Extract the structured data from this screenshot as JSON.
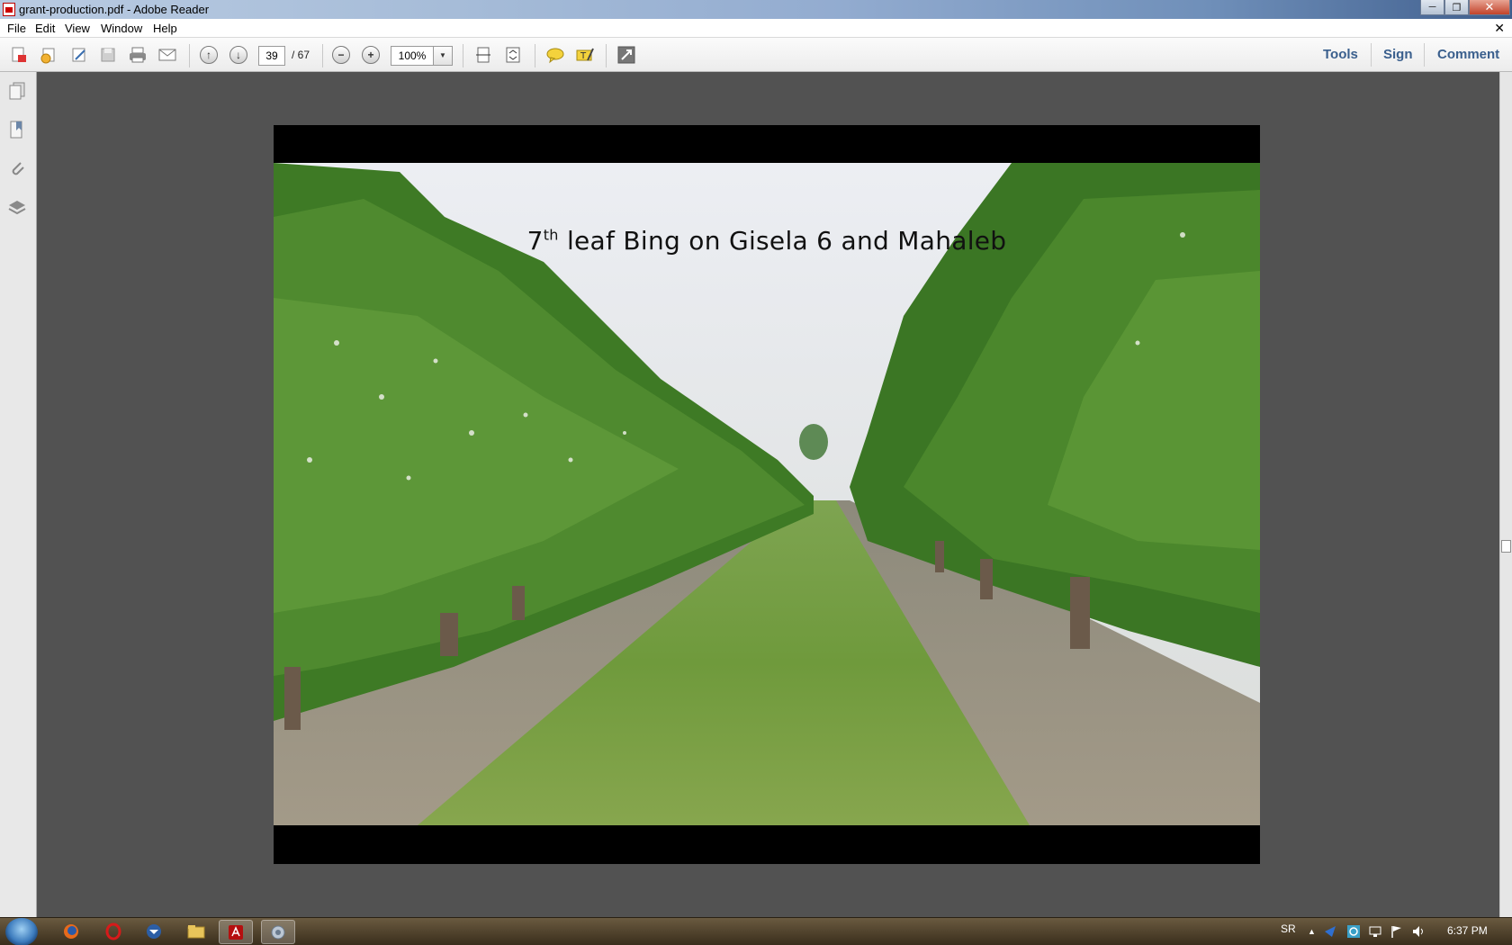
{
  "window": {
    "title": "grant-production.pdf - Adobe Reader"
  },
  "menu": [
    "File",
    "Edit",
    "View",
    "Window",
    "Help"
  ],
  "toolbar": {
    "page_current": "39",
    "page_total": "/ 67",
    "zoom": "100%",
    "links": [
      "Tools",
      "Sign",
      "Comment"
    ]
  },
  "slide": {
    "title_prefix": "7",
    "title_sup": "th",
    "title_rest": " leaf Bing on Gisela 6 and Mahaleb"
  },
  "taskbar": {
    "lang": "SR",
    "time": "6:37 PM"
  },
  "colors": {
    "link": "#3a5f8d",
    "doc_bg": "#525252",
    "foliage": "#3f7a24"
  }
}
